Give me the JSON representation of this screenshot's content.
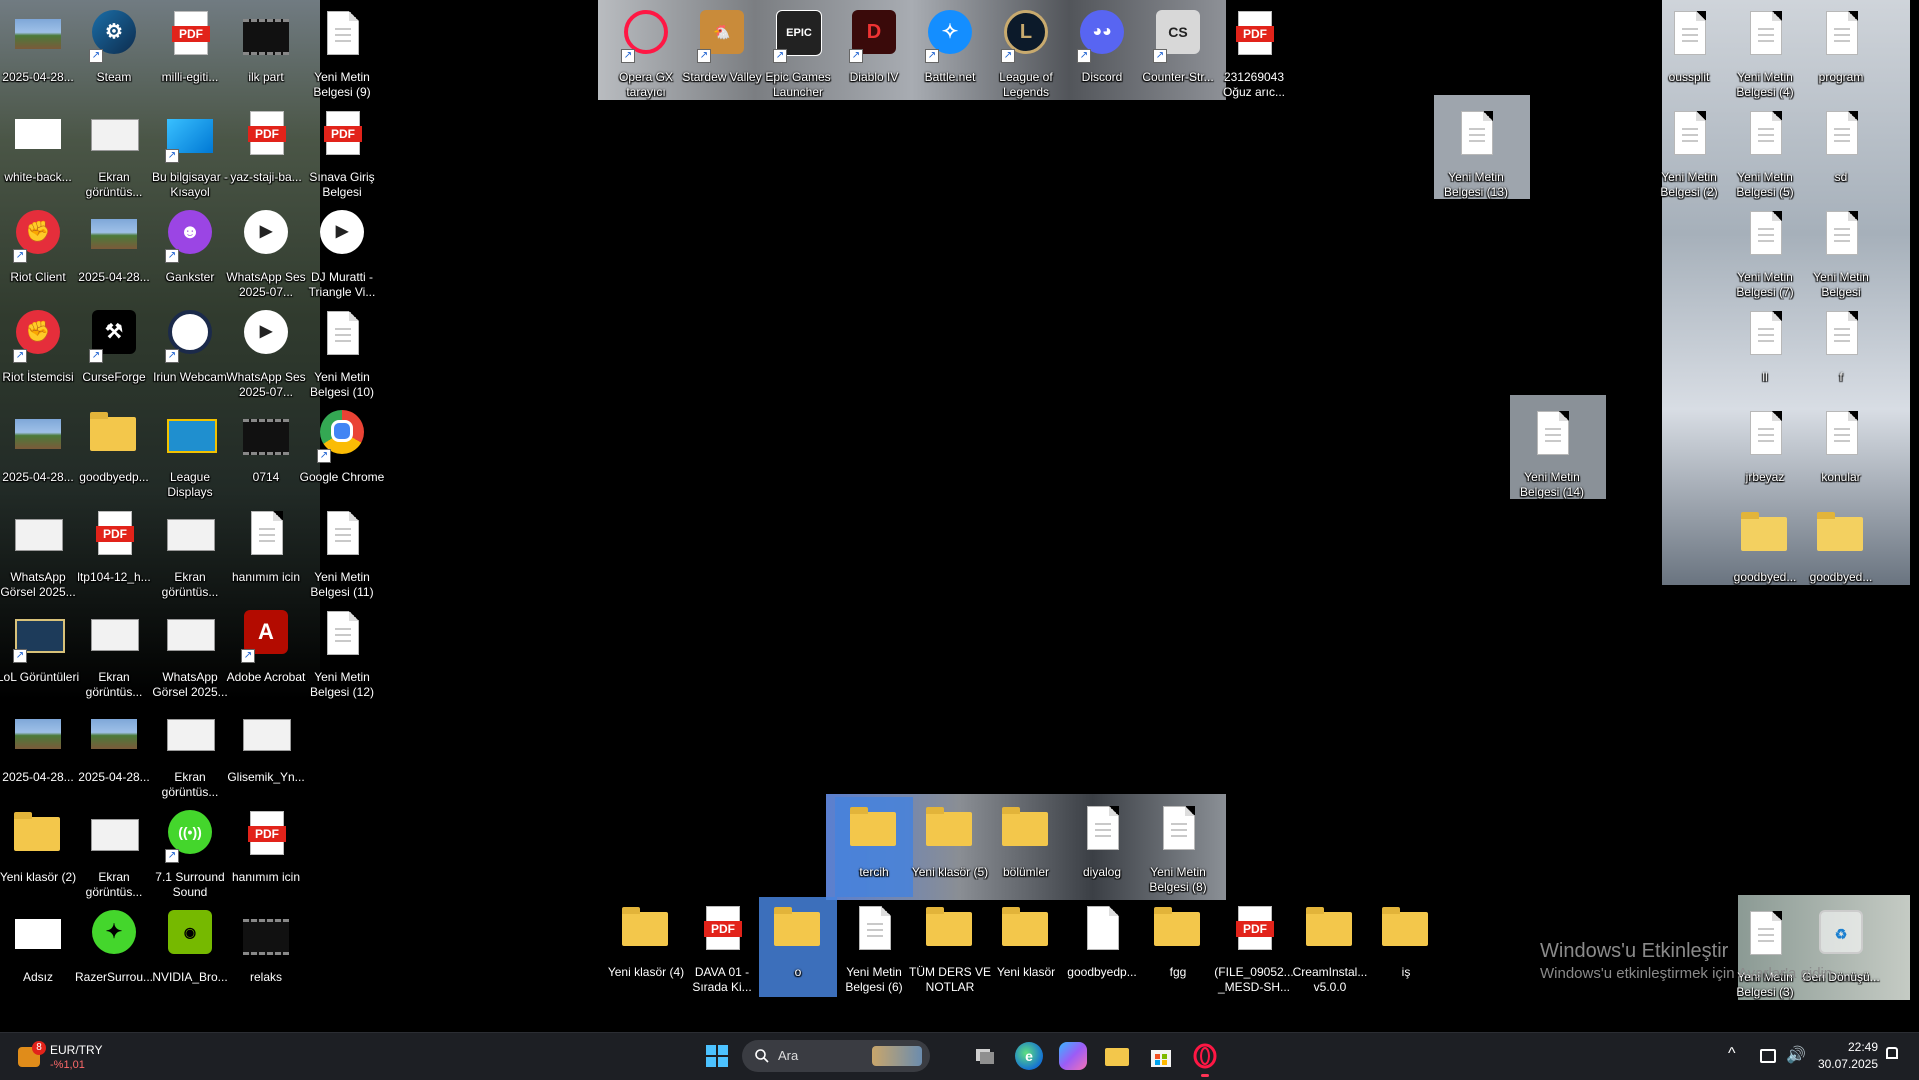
{
  "desktop": {
    "icons": {
      "c1": [
        "2025-04-28...",
        "white-back...",
        "Riot Client",
        "Riot İstemcisi",
        "2025-04-28...",
        "WhatsApp Görsel 2025...",
        "LoL Görüntüleri",
        "2025-04-28...",
        "Yeni klasör (2)",
        "Adsız"
      ],
      "c2": [
        "Steam",
        "Ekran görüntüs...",
        "2025-04-28...",
        "CurseForge",
        "goodbyedp...",
        "ltp104-12_h...",
        "Ekran görüntüs...",
        "2025-04-28...",
        "Ekran görüntüs...",
        "RazerSurrou..."
      ],
      "c3": [
        "milli-egiti...",
        "Bu bilgisayar - Kısayol",
        "Gankster",
        "Iriun Webcam",
        "League Displays",
        "Ekran görüntüs...",
        "WhatsApp Görsel 2025...",
        "Ekran görüntüs...",
        "7.1 Surround Sound",
        "NVIDIA_Bro..."
      ],
      "c4": [
        "ilk part",
        "yaz-staji-ba...",
        "WhatsApp Ses 2025-07...",
        "WhatsApp Ses 2025-07...",
        "0714",
        "hanımım icin",
        "Adobe Acrobat",
        "Glisemik_Yn...",
        "hanımım icin",
        "relaks"
      ],
      "c5": [
        "Yeni Metin Belgesi (9)",
        "Sınava Giriş Belgesi",
        "DJ Muratti - Triangle Vi...",
        "Yeni Metin Belgesi (10)",
        "Google Chrome",
        "Yeni Metin Belgesi (11)",
        "Yeni Metin Belgesi (12)"
      ],
      "top": [
        "Opera GX tarayıcı",
        "Stardew Valley",
        "Epic Games Launcher",
        "Diablo IV",
        "Battle.net",
        "League of Legends",
        "Discord",
        "Counter-Str...",
        "231269043 Oğuz arıc..."
      ],
      "mid": [
        "Yeni Metin Belgesi (13)",
        "Yeni Metin Belgesi (14)"
      ],
      "right": [
        "oussplit",
        "Yeni Metin Belgesi (4)",
        "program",
        "Yeni Metin Belgesi (2)",
        "Yeni Metin Belgesi (5)",
        "sd",
        "Yeni Metin Belgesi (7)",
        "Yeni Metin Belgesi",
        "ll",
        "f",
        "jrbeyaz",
        "konular",
        "goodbyed...",
        "goodbyed...",
        "Yeni Metin Belgesi (3)",
        "Geri Dönüşü..."
      ],
      "bottom1": [
        "tercih",
        "Yeni klasör (5)",
        "bölümler",
        "diyalog",
        "Yeni Metin Belgesi (8)"
      ],
      "bottom2": [
        "Yeni klasör (4)",
        "DAVA 01 - Sırada Ki...",
        "o",
        "Yeni Metin Belgesi (6)",
        "TÜM DERS VE NOTLAR",
        "Yeni klasör",
        "goodbyedp...",
        "fgg",
        "(FILE_09052... _MESD-SH...",
        "CreamInstal... v5.0.0",
        "iş"
      ]
    }
  },
  "watermark": {
    "title": "Windows'u Etkinleştir",
    "subtitle": "Windows'u etkinleştirmek için Ayarlar'a gidin."
  },
  "taskbar": {
    "widget": {
      "badge": "8",
      "name": "EUR/TRY",
      "change": "-%1,01"
    },
    "search_placeholder": "Ara",
    "time": "22:49",
    "date": "30.07.2025"
  },
  "colors": {
    "accent_red": "#e2231a",
    "selection": "#4682dc",
    "taskbar": "#1d1f24"
  }
}
